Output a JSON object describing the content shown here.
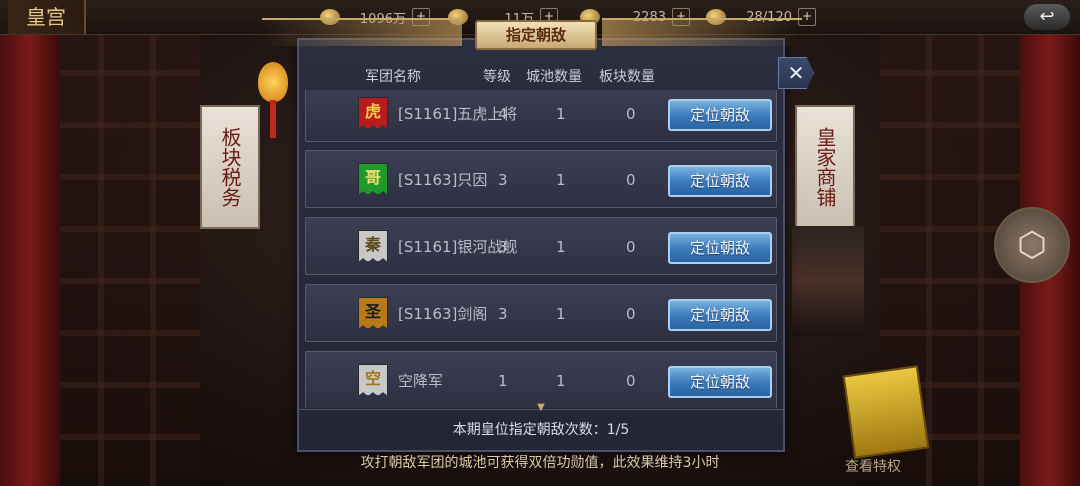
{
  "topbar": {
    "palace_title": "皇宫",
    "resources": [
      {
        "icon": "coin-pile-icon",
        "value": "1096万",
        "plus": "+"
      },
      {
        "icon": "grain-icon",
        "value": "11万",
        "plus": "+"
      },
      {
        "icon": "gold-ingot-icon",
        "value": "2283",
        "plus": "+"
      },
      {
        "icon": "stamina-icon",
        "value": "28/120",
        "plus": "+"
      }
    ],
    "back_icon": "back-arrow-icon"
  },
  "side": {
    "left_banner": "板块税务",
    "right_banner": "皇家商铺",
    "privilege_label": "查看特权"
  },
  "dialog": {
    "title": "指定朝敌",
    "close": "✕",
    "headers": {
      "name": "军团名称",
      "level": "等级",
      "cities": "城池数量",
      "blocks": "板块数量"
    },
    "rows": [
      {
        "badge": "虎",
        "badge_color": "#b81c1c",
        "badge_text_color": "#f4d04a",
        "name": "[S1161]五虎上将",
        "level": "4",
        "cities": "1",
        "blocks": "0",
        "button": "定位朝敌"
      },
      {
        "badge": "哥",
        "badge_color": "#1f9a2a",
        "badge_text_color": "#f4e070",
        "name": "[S1163]只因",
        "level": "3",
        "cities": "1",
        "blocks": "0",
        "button": "定位朝敌"
      },
      {
        "badge": "秦",
        "badge_color": "#c8c8c8",
        "badge_text_color": "#5a4a20",
        "name": "[S1161]银河战舰",
        "level": "3",
        "cities": "1",
        "blocks": "0",
        "button": "定位朝敌"
      },
      {
        "badge": "圣",
        "badge_color": "#b87a14",
        "badge_text_color": "#1a1a1a",
        "name": "[S1163]剑阁",
        "level": "3",
        "cities": "1",
        "blocks": "0",
        "button": "定位朝敌"
      },
      {
        "badge": "空",
        "badge_color": "#c8c8c8",
        "badge_text_color": "#a0781a",
        "name": "空降军",
        "level": "1",
        "cities": "1",
        "blocks": "0",
        "button": "定位朝敌"
      }
    ],
    "footer": "本期皇位指定朝敌次数：1/5"
  },
  "tip": "攻打朝敌军团的城池可获得双倍功勋值，此效果维持3小时"
}
